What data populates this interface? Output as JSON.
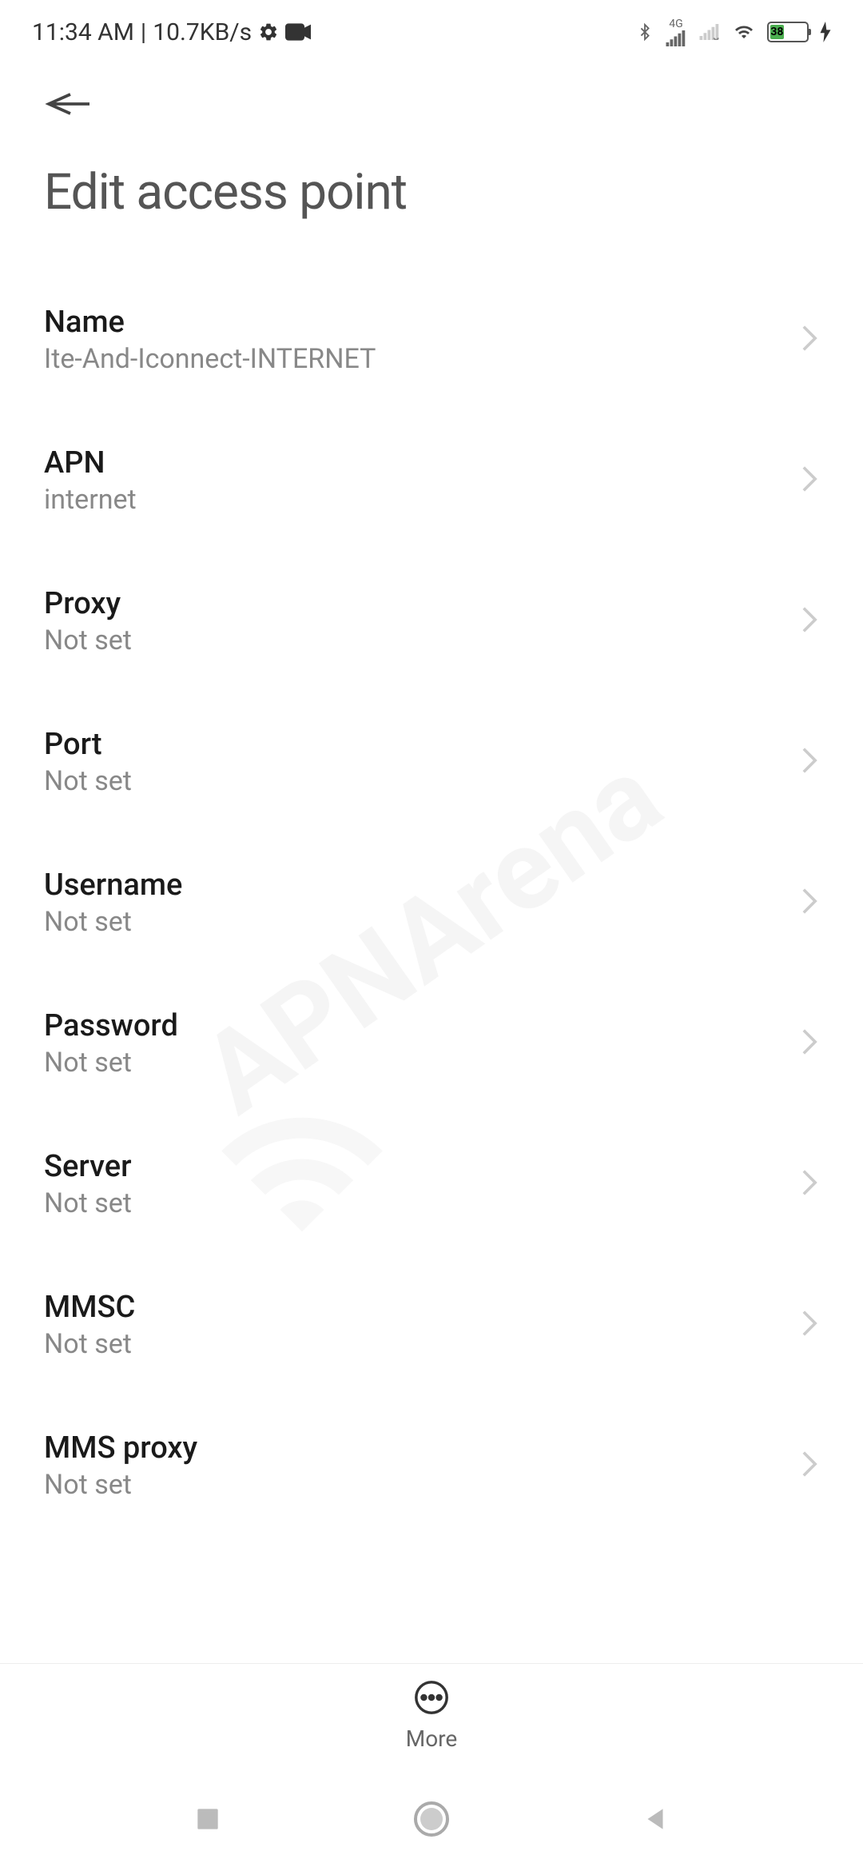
{
  "status_bar": {
    "time": "11:34 AM",
    "separator": "|",
    "data_rate": "10.7KB/s",
    "battery_percent": "38",
    "network_label": "4G"
  },
  "header": {
    "title": "Edit access point"
  },
  "settings": [
    {
      "label": "Name",
      "value": "Ite-And-Iconnect-INTERNET"
    },
    {
      "label": "APN",
      "value": "internet"
    },
    {
      "label": "Proxy",
      "value": "Not set"
    },
    {
      "label": "Port",
      "value": "Not set"
    },
    {
      "label": "Username",
      "value": "Not set"
    },
    {
      "label": "Password",
      "value": "Not set"
    },
    {
      "label": "Server",
      "value": "Not set"
    },
    {
      "label": "MMSC",
      "value": "Not set"
    },
    {
      "label": "MMS proxy",
      "value": "Not set"
    }
  ],
  "toolbar": {
    "more_label": "More"
  },
  "watermark": "APNArena"
}
